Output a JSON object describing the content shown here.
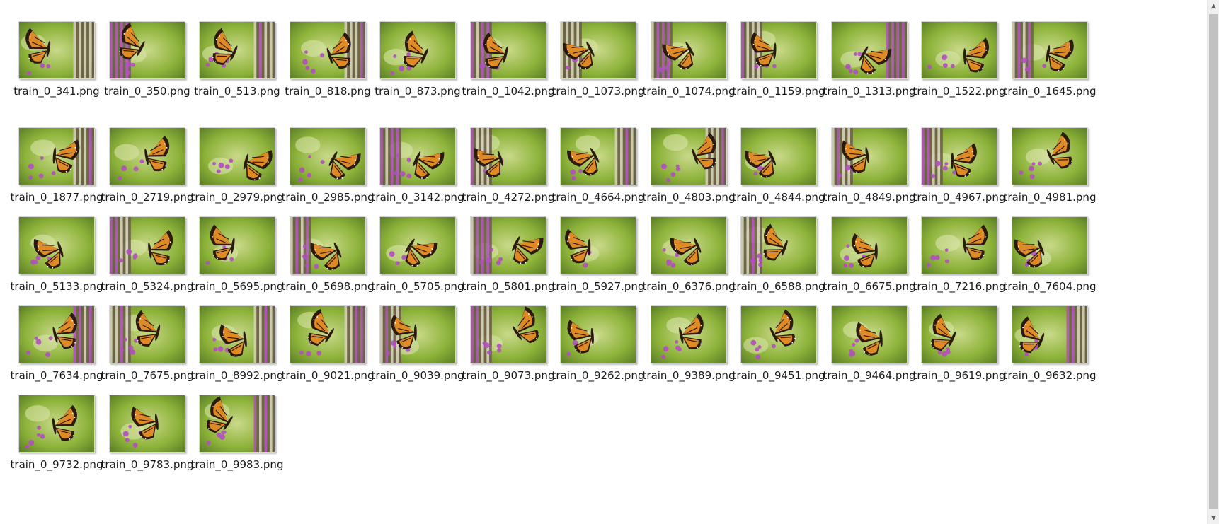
{
  "files": [
    "train_0_341.png",
    "train_0_350.png",
    "train_0_513.png",
    "train_0_818.png",
    "train_0_873.png",
    "train_0_1042.png",
    "train_0_1073.png",
    "train_0_1074.png",
    "train_0_1159.png",
    "train_0_1313.png",
    "train_0_1522.png",
    "train_0_1645.png",
    "train_0_1877.png",
    "train_0_2719.png",
    "train_0_2979.png",
    "train_0_2985.png",
    "train_0_3142.png",
    "train_0_4272.png",
    "train_0_4664.png",
    "train_0_4803.png",
    "train_0_4844.png",
    "train_0_4849.png",
    "train_0_4967.png",
    "train_0_4981.png",
    "train_0_5133.png",
    "train_0_5324.png",
    "train_0_5695.png",
    "train_0_5698.png",
    "train_0_5705.png",
    "train_0_5801.png",
    "train_0_5927.png",
    "train_0_6376.png",
    "train_0_6588.png",
    "train_0_6675.png",
    "train_0_7216.png",
    "train_0_7604.png",
    "train_0_7634.png",
    "train_0_7675.png",
    "train_0_8992.png",
    "train_0_9021.png",
    "train_0_9039.png",
    "train_0_9073.png",
    "train_0_9262.png",
    "train_0_9389.png",
    "train_0_9451.png",
    "train_0_9464.png",
    "train_0_9619.png",
    "train_0_9632.png",
    "train_0_9732.png",
    "train_0_9783.png",
    "train_0_9983.png"
  ],
  "scrollbar": {
    "up_icon": "chevron-up-icon",
    "down_icon": "chevron-down-icon",
    "up_glyph": "▲",
    "down_glyph": "▼"
  },
  "colors": {
    "leaf_green": "#8db33a",
    "purple": "#b24fc0",
    "wing_orange": "#e08a25",
    "wing_black": "#2a1a10"
  }
}
